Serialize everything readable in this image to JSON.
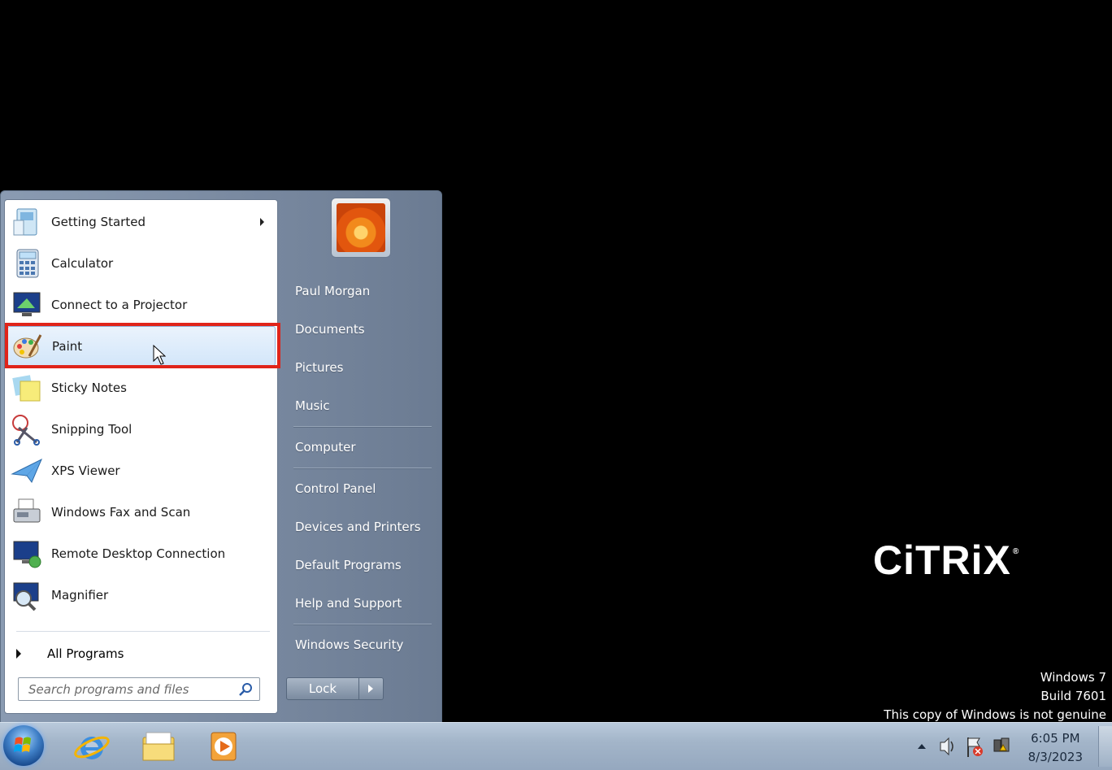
{
  "start_menu": {
    "programs": [
      {
        "label": "Getting Started",
        "icon": "getting-started-icon",
        "has_submenu": true
      },
      {
        "label": "Calculator",
        "icon": "calculator-icon"
      },
      {
        "label": "Connect to a Projector",
        "icon": "projector-icon"
      },
      {
        "label": "Paint",
        "icon": "paint-icon",
        "highlighted": true
      },
      {
        "label": "Sticky Notes",
        "icon": "sticky-notes-icon"
      },
      {
        "label": "Snipping Tool",
        "icon": "snipping-tool-icon"
      },
      {
        "label": "XPS Viewer",
        "icon": "xps-viewer-icon"
      },
      {
        "label": "Windows Fax and Scan",
        "icon": "fax-scan-icon"
      },
      {
        "label": "Remote Desktop Connection",
        "icon": "remote-desktop-icon"
      },
      {
        "label": "Magnifier",
        "icon": "magnifier-icon"
      }
    ],
    "all_programs_label": "All Programs",
    "search_placeholder": "Search programs and files",
    "right_links": {
      "user": "Paul Morgan",
      "documents": "Documents",
      "pictures": "Pictures",
      "music": "Music",
      "computer": "Computer",
      "control_panel": "Control Panel",
      "devices": "Devices and Printers",
      "default_programs": "Default Programs",
      "help": "Help and Support",
      "security": "Windows Security"
    },
    "lock_label": "Lock"
  },
  "desktop": {
    "logo_text": "CiTRiX",
    "watermark": [
      "Windows 7",
      "Build 7601",
      "This copy of Windows is not genuine"
    ]
  },
  "taskbar": {
    "pinned": [
      "internet-explorer-icon",
      "windows-explorer-icon",
      "media-player-icon"
    ],
    "clock_time": "6:05 PM",
    "clock_date": "8/3/2023"
  },
  "colors": {
    "highlight_border": "#e0241a",
    "taskbar": "#a3b5c9"
  }
}
